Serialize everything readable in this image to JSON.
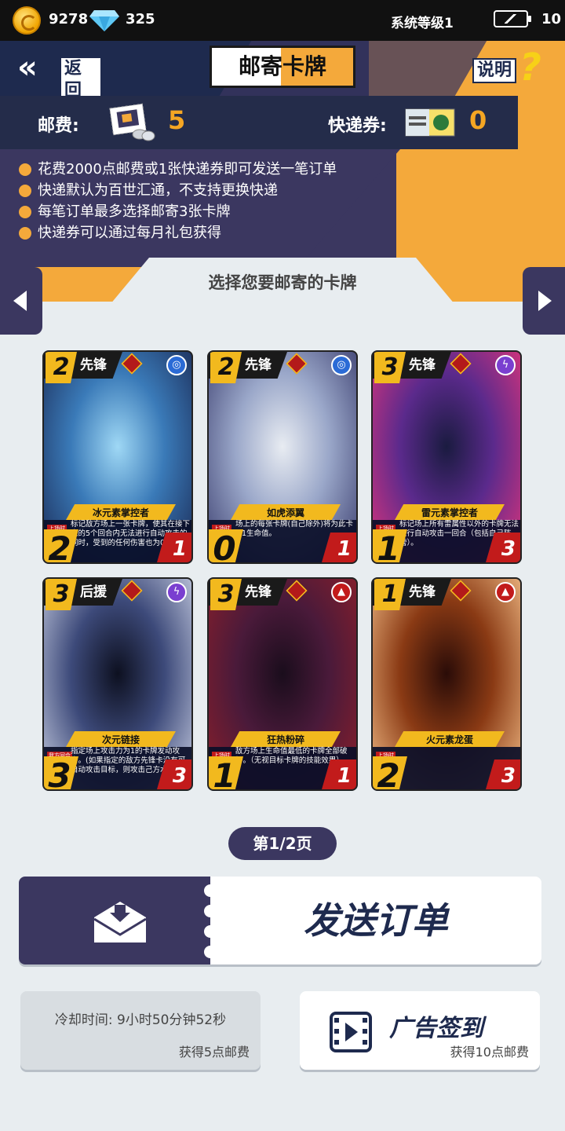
{
  "status_bar": {
    "coins": "9278",
    "gems": "325",
    "system_level": "系统等级1",
    "energy": "10"
  },
  "header": {
    "back_label": "返回",
    "title": "邮寄卡牌",
    "help_label": "说明",
    "help_icon": "?"
  },
  "postage": {
    "postage_label": "邮费:",
    "postage_value": "5",
    "ticket_label": "快递券:",
    "ticket_value": "0"
  },
  "info": {
    "items": [
      "花费2000点邮费或1张快递券即可发送一笔订单",
      "快递默认为百世汇通，不支持更换快递",
      "每笔订单最多选择邮寄3张卡牌",
      "快递券可以通过每月礼包获得"
    ]
  },
  "select_title": "选择您要邮寄的卡牌",
  "cards": [
    {
      "cost": "2",
      "type": "先锋",
      "name": "冰元素掌控者",
      "tag": "上场时",
      "desc": "标记敌方场上一张卡牌，使其在接下来的5个回合内无法进行自动攻击的同时，受到的任何伤害也为0。",
      "attack": "2",
      "hp": "1",
      "element": "water",
      "art": [
        "#9fd8f5",
        "#3a7ab8",
        "#1b2a55"
      ]
    },
    {
      "cost": "2",
      "type": "先锋",
      "name": "如虎添翼",
      "tag": "上场时",
      "desc": "场上的每张卡牌(自己除外)将为此卡+1生命值。",
      "attack": "0",
      "hp": "1",
      "element": "water",
      "art": [
        "#e8ecf2",
        "#9aa7c9",
        "#3a3d6e"
      ]
    },
    {
      "cost": "3",
      "type": "先锋",
      "name": "雷元素掌控者",
      "tag": "上场时",
      "desc": "标记场上所有雷属性以外的卡牌无法进行自动攻击一回合（包括自己阵营）。",
      "attack": "1",
      "hp": "3",
      "element": "thunder",
      "art": [
        "#1a1b40",
        "#5b2a8c",
        "#e0357a"
      ]
    },
    {
      "cost": "3",
      "type": "后援",
      "name": "次元链接",
      "tag": "我方回合",
      "desc": "指定场上攻击力为1的卡牌发动攻击。(如果指定的敌方先锋卡没有可自动攻击目标，则攻击己方水晶)",
      "attack": "3",
      "hp": "3",
      "element": "thunder",
      "art": [
        "#0d1020",
        "#3d4a7a",
        "#c9cfe3"
      ]
    },
    {
      "cost": "3",
      "type": "先锋",
      "name": "狂热粉碎",
      "tag": "上场时",
      "desc": "敌方场上生命值最低的卡牌全部破坏。（无视目标卡牌的技能效果）",
      "attack": "1",
      "hp": "1",
      "element": "fire",
      "art": [
        "#1a0d1c",
        "#4a1a3a",
        "#8c1f2a"
      ]
    },
    {
      "cost": "1",
      "type": "先锋",
      "name": "火元素龙蛋",
      "tag": "上场时",
      "desc": "",
      "attack": "2",
      "hp": "3",
      "element": "fire",
      "art": [
        "#2a0c08",
        "#8a3a14",
        "#f5c08a"
      ]
    }
  ],
  "page_indicator": "第1/2页",
  "send_order_label": "发送订单",
  "cooldown": {
    "time_text": "冷却时间: 9小时50分钟52秒",
    "reward_text": "获得5点邮费"
  },
  "ad_checkin": {
    "label": "广告签到",
    "reward_text": "获得10点邮费"
  },
  "colors": {
    "navy": "#1e2a4e",
    "purple_navy": "#3b3760",
    "orange": "#f4a93b",
    "gold": "#f2b91e",
    "red": "#c21b1b"
  }
}
